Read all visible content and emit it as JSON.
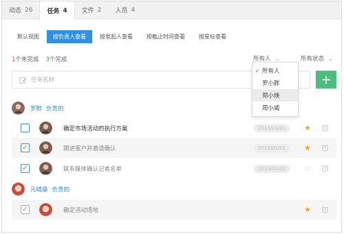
{
  "top_tabs": [
    {
      "label": "动态",
      "count": "26"
    },
    {
      "label": "任务",
      "count": "4"
    },
    {
      "label": "文件",
      "count": "2"
    },
    {
      "label": "人员",
      "count": "4"
    }
  ],
  "views": [
    {
      "label": "默认视图"
    },
    {
      "label": "按负责人查看"
    },
    {
      "label": "按发起人查看"
    },
    {
      "label": "按截止时间查看"
    },
    {
      "label": "按星标查看"
    }
  ],
  "summary": {
    "incomplete_num": "1",
    "incomplete_label": "个未完成",
    "complete_num": "3",
    "complete_label": "个完成"
  },
  "filters": {
    "people": "所有人",
    "status": "所有状态"
  },
  "search": {
    "placeholder": "任务名称"
  },
  "add_button": {
    "label": "+"
  },
  "dropdown": {
    "check": "✓",
    "items": [
      "所有人",
      "罗小胖",
      "郑小焕",
      "周小威"
    ]
  },
  "groups": [
    {
      "name": "罗胖",
      "role": "负责的",
      "tasks": [
        {
          "title": "确定市场活动的执行方案",
          "date": "2013/01/01",
          "checked": false,
          "starred": true
        },
        {
          "title": "跟进客户并邀请确认",
          "date": "2013/01/01",
          "checked": true,
          "starred": true
        },
        {
          "title": "联系媒体确认记者名单",
          "date": "2013/01/02",
          "checked": true,
          "starred": false
        }
      ]
    },
    {
      "name": "元晴康",
      "role": "负责的",
      "tasks": [
        {
          "title": "确定活动场地",
          "date": "",
          "checked": true,
          "starred": true
        }
      ]
    }
  ],
  "icons": {
    "star": "star-icon",
    "clock": "alarm-clock-icon",
    "edit": "edit-icon",
    "check": "checkmark-icon"
  },
  "colors": {
    "accent": "#2e91e4",
    "add_button": "#4bbd7c",
    "star": "#f2a21b",
    "incomplete": "#e04b3a",
    "complete": "#3aa35c"
  }
}
